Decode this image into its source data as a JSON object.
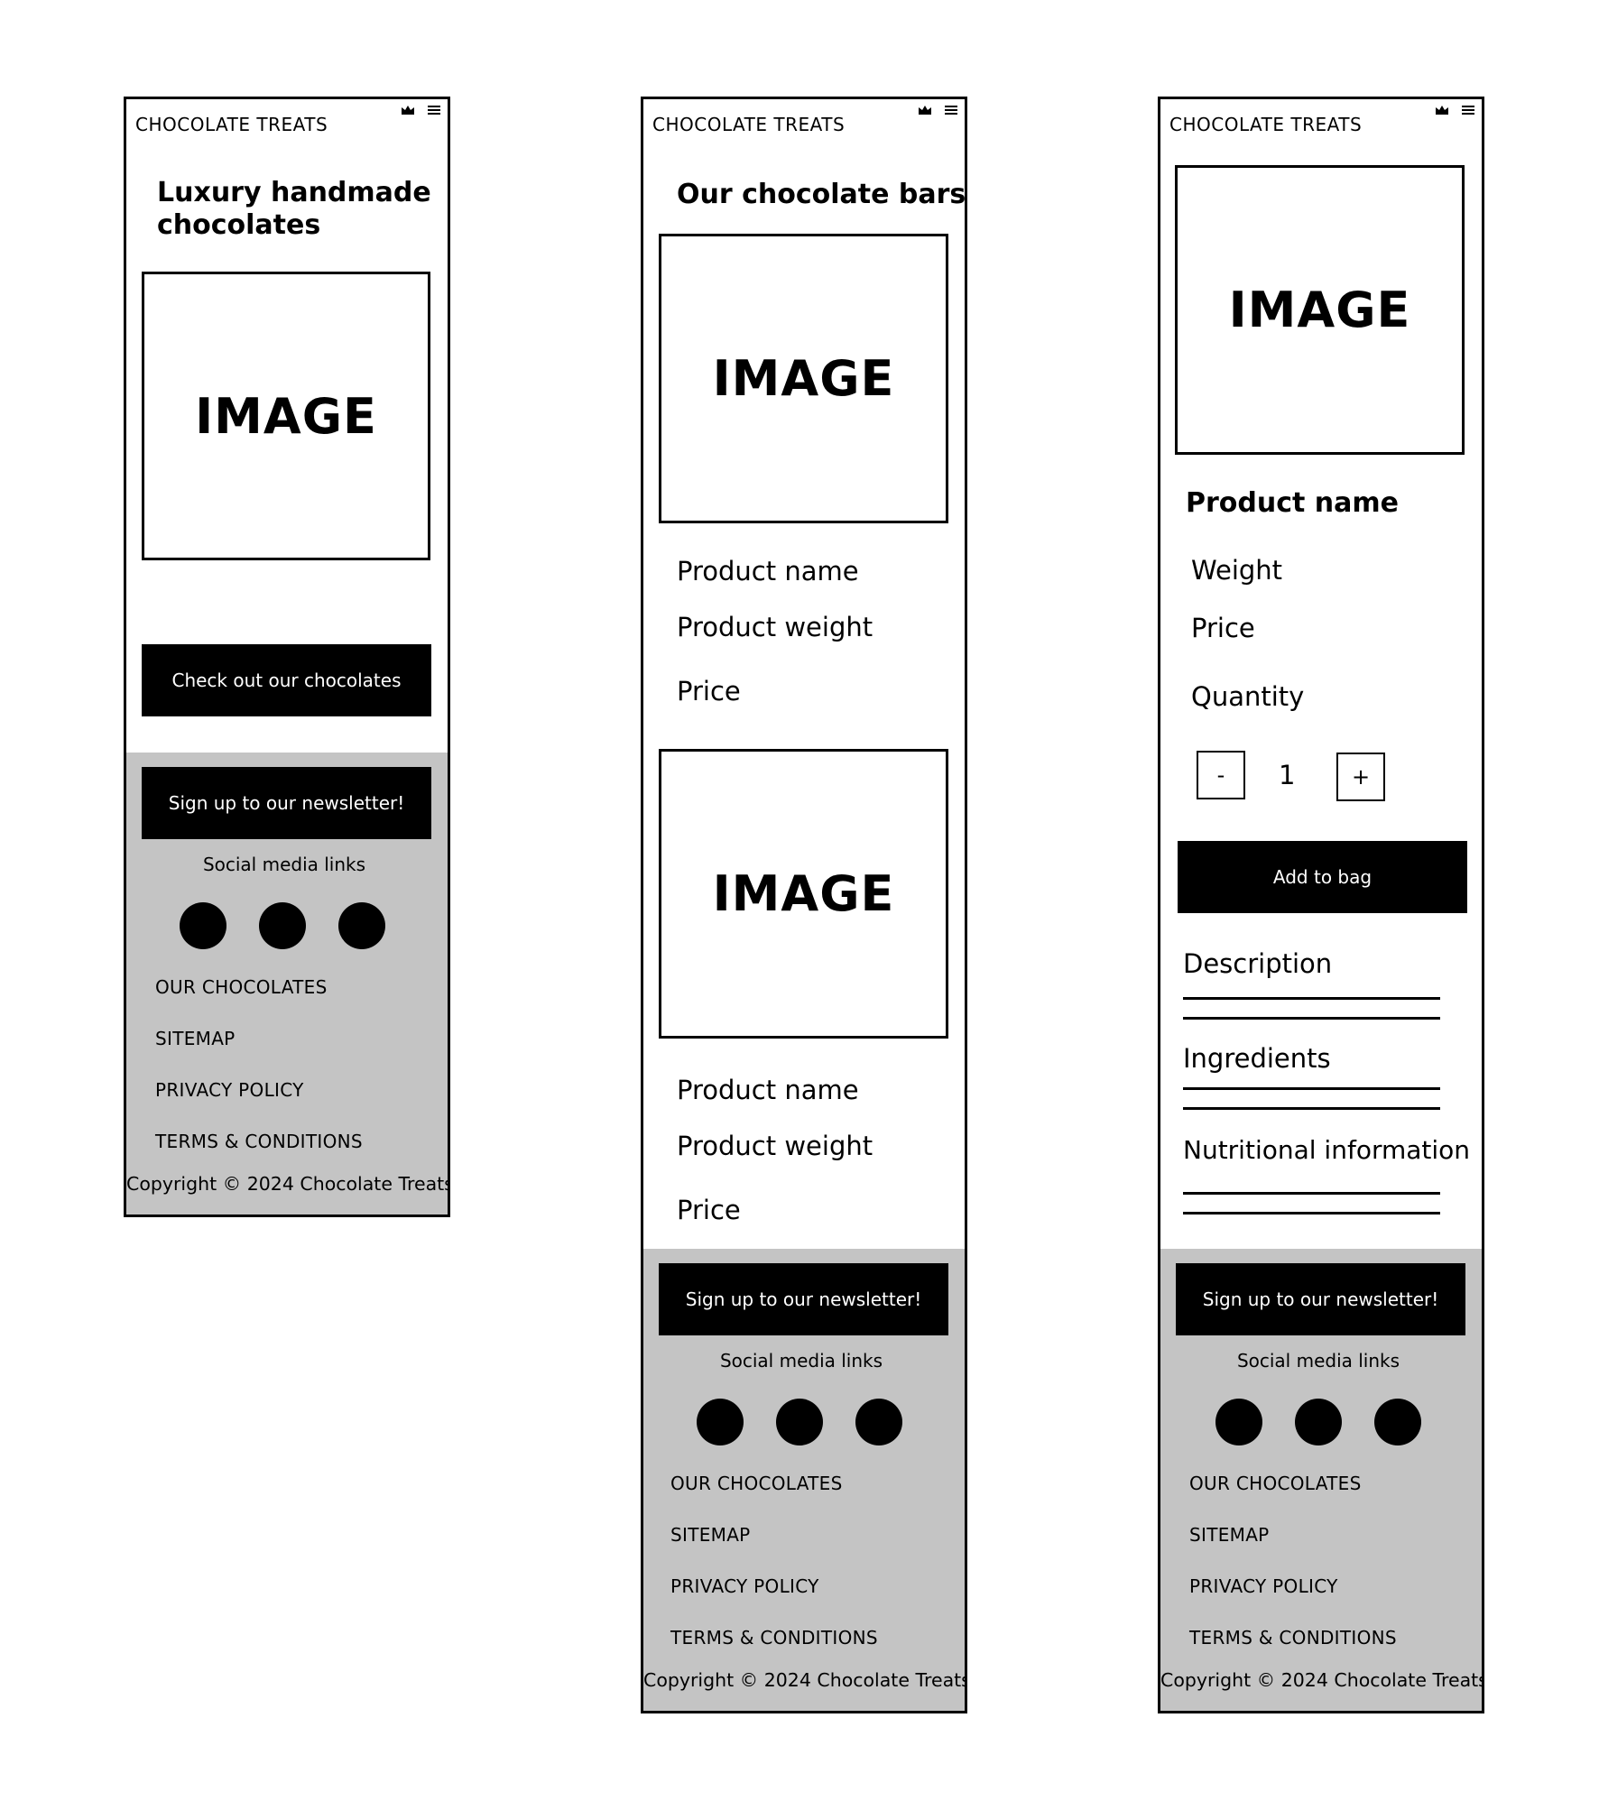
{
  "brand": "CHOCOLATE TREATS",
  "icons": {
    "crown": "crown-icon",
    "menu": "hamburger-menu-icon"
  },
  "screen1": {
    "heading_line1": "Luxury handmade",
    "heading_line2": "chocolates",
    "image_label": "IMAGE",
    "cta_label": "Check out our chocolates"
  },
  "screen2": {
    "heading": "Our chocolate bars",
    "products": [
      {
        "image_label": "IMAGE",
        "name": "Product name",
        "weight": "Product weight",
        "price": "Price"
      },
      {
        "image_label": "IMAGE",
        "name": "Product name",
        "weight": "Product weight",
        "price": "Price"
      }
    ]
  },
  "screen3": {
    "image_label": "IMAGE",
    "product_name": "Product name",
    "weight": "Weight",
    "price": "Price",
    "quantity_label": "Quantity",
    "decrement": "-",
    "quantity_value": "1",
    "increment": "+",
    "add_to_bag": "Add to bag",
    "description": "Description",
    "ingredients": "Ingredients",
    "nutritional": "Nutritional information"
  },
  "footer": {
    "newsletter": "Sign up to our newsletter!",
    "social_label": "Social media links",
    "links": [
      "OUR CHOCOLATES",
      "SITEMAP",
      "PRIVACY POLICY",
      "TERMS & CONDITIONS"
    ],
    "copyright": "Copyright © 2024 Chocolate Treats"
  }
}
